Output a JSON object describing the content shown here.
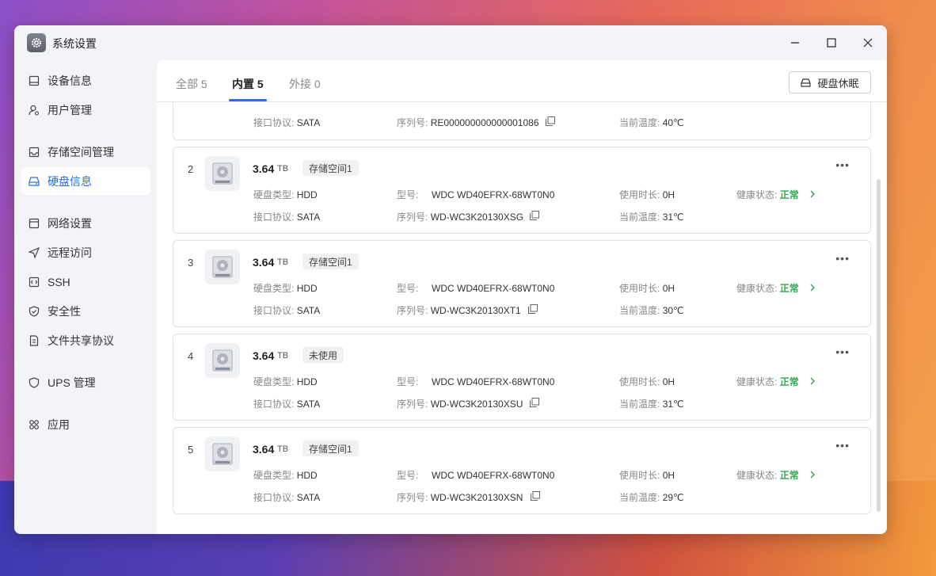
{
  "window": {
    "title": "系统设置",
    "app_icon": "gear-icon",
    "controls": {
      "minimize": "minimize-icon",
      "maximize": "maximize-icon",
      "close": "close-icon"
    }
  },
  "sidebar": {
    "items": [
      {
        "label": "设备信息",
        "icon": "monitor-icon"
      },
      {
        "label": "用户管理",
        "icon": "user-gear-icon"
      },
      {
        "label": "存储空间管理",
        "icon": "storage-icon"
      },
      {
        "label": "硬盘信息",
        "icon": "disk-icon",
        "active": true
      },
      {
        "label": "网络设置",
        "icon": "network-icon"
      },
      {
        "label": "远程访问",
        "icon": "send-icon"
      },
      {
        "label": "SSH",
        "icon": "code-icon"
      },
      {
        "label": "安全性",
        "icon": "shield-check-icon"
      },
      {
        "label": "文件共享协议",
        "icon": "document-icon"
      },
      {
        "label": "UPS 管理",
        "icon": "shield-icon"
      },
      {
        "label": "应用",
        "icon": "apps-icon"
      }
    ]
  },
  "tabs": [
    {
      "label": "全部 5",
      "active": false
    },
    {
      "label": "内置 5",
      "active": true
    },
    {
      "label": "外接 0",
      "active": false
    }
  ],
  "sleep_button": {
    "label": "硬盘休眠",
    "icon": "disk-icon"
  },
  "labels": {
    "disk_type": "硬盘类型:",
    "model": "型号:",
    "uptime": "使用时长:",
    "health": "健康状态:",
    "interface": "接口协议:",
    "serial": "序列号:",
    "temperature": "当前温度:"
  },
  "partial_disk": {
    "interface": "SATA",
    "serial": "RE000000000000001086",
    "temperature": "40℃"
  },
  "disks": [
    {
      "index": "2",
      "size": "3.64",
      "unit": "TB",
      "badge": "存储空间1",
      "type": "HDD",
      "model": "WDC WD40EFRX-68WT0N0",
      "uptime": "0H",
      "health": "正常",
      "interface": "SATA",
      "serial": "WD-WC3K20130XSG",
      "temperature": "31℃"
    },
    {
      "index": "3",
      "size": "3.64",
      "unit": "TB",
      "badge": "存储空间1",
      "type": "HDD",
      "model": "WDC WD40EFRX-68WT0N0",
      "uptime": "0H",
      "health": "正常",
      "interface": "SATA",
      "serial": "WD-WC3K20130XT1",
      "temperature": "30℃"
    },
    {
      "index": "4",
      "size": "3.64",
      "unit": "TB",
      "badge": "未使用",
      "type": "HDD",
      "model": "WDC WD40EFRX-68WT0N0",
      "uptime": "0H",
      "health": "正常",
      "interface": "SATA",
      "serial": "WD-WC3K20130XSU",
      "temperature": "31℃"
    },
    {
      "index": "5",
      "size": "3.64",
      "unit": "TB",
      "badge": "存储空间1",
      "type": "HDD",
      "model": "WDC WD40EFRX-68WT0N0",
      "uptime": "0H",
      "health": "正常",
      "interface": "SATA",
      "serial": "WD-WC3K20130XSN",
      "temperature": "29℃"
    }
  ],
  "colors": {
    "accent": "#2a6ee6",
    "healthy": "#2fa84f"
  }
}
